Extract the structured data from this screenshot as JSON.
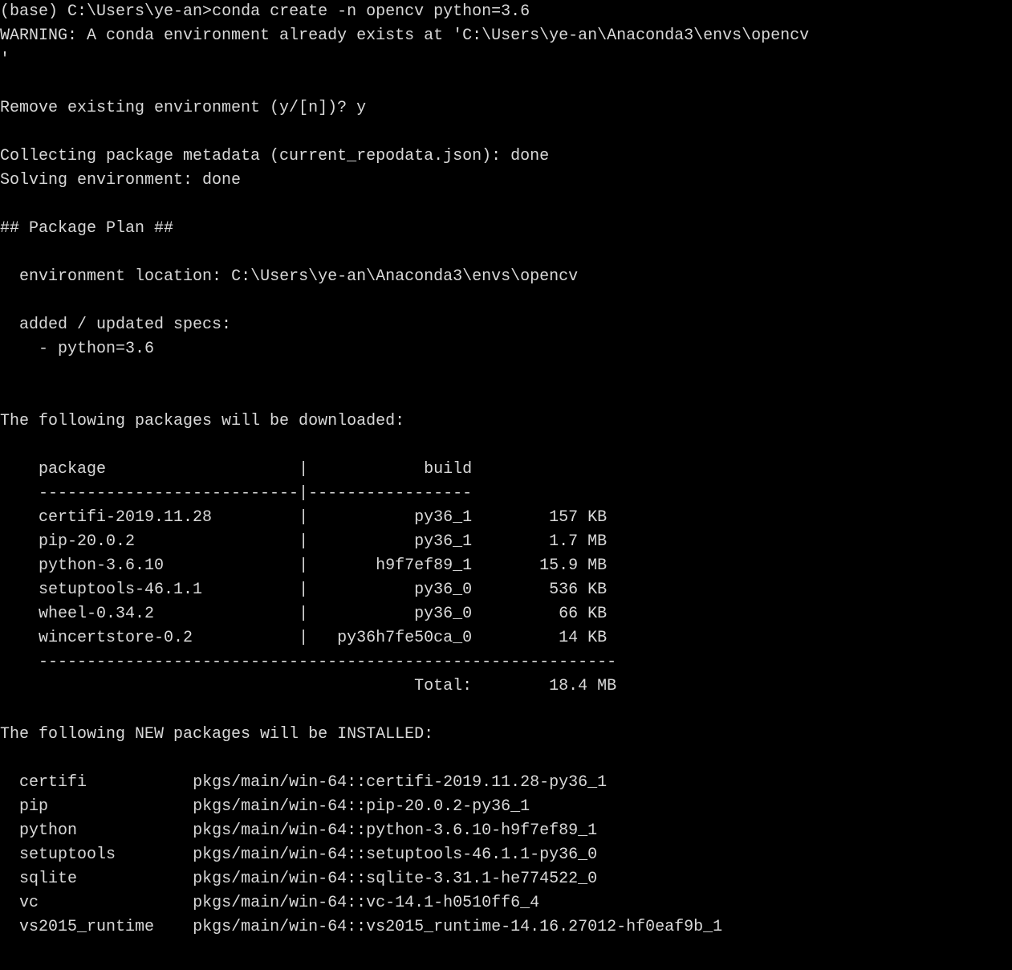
{
  "prompt_env": "(base)",
  "prompt_cwd": "C:\\Users\\ye-an>",
  "prompt_cmd": "conda create -n opencv python=3.6",
  "warning_line": "WARNING: A conda environment already exists at 'C:\\Users\\ye-an\\Anaconda3\\envs\\opencv",
  "warning_tail": "'",
  "remove_prompt": "Remove existing environment (y/[n])?",
  "remove_answer": "y",
  "collecting_line": "Collecting package metadata (current_repodata.json): done",
  "solving_line": "Solving environment: done",
  "plan_header": "## Package Plan ##",
  "env_location_label": "environment location:",
  "env_location_value": "C:\\Users\\ye-an\\Anaconda3\\envs\\opencv",
  "specs_label": "added / updated specs:",
  "spec1": "- python=3.6",
  "dl_intro": "The following packages will be downloaded:",
  "dl_header_package": "package",
  "dl_header_build": "build",
  "dl_sep_top": "    ---------------------------|-----------------",
  "dl_sep_bottom": "    ------------------------------------------------------------",
  "dl_rows": [
    {
      "pkg": "certifi-2019.11.28",
      "build": "py36_1",
      "size": "157 KB"
    },
    {
      "pkg": "pip-20.0.2",
      "build": "py36_1",
      "size": "1.7 MB"
    },
    {
      "pkg": "python-3.6.10",
      "build": "h9f7ef89_1",
      "size": "15.9 MB"
    },
    {
      "pkg": "setuptools-46.1.1",
      "build": "py36_0",
      "size": "536 KB"
    },
    {
      "pkg": "wheel-0.34.2",
      "build": "py36_0",
      "size": "66 KB"
    },
    {
      "pkg": "wincertstore-0.2",
      "build": "py36h7fe50ca_0",
      "size": "14 KB"
    }
  ],
  "total_label": "Total:",
  "total_value": "18.4 MB",
  "install_intro": "The following NEW packages will be INSTALLED:",
  "install_rows": [
    {
      "name": "certifi",
      "spec": "pkgs/main/win-64::certifi-2019.11.28-py36_1"
    },
    {
      "name": "pip",
      "spec": "pkgs/main/win-64::pip-20.0.2-py36_1"
    },
    {
      "name": "python",
      "spec": "pkgs/main/win-64::python-3.6.10-h9f7ef89_1"
    },
    {
      "name": "setuptools",
      "spec": "pkgs/main/win-64::setuptools-46.1.1-py36_0"
    },
    {
      "name": "sqlite",
      "spec": "pkgs/main/win-64::sqlite-3.31.1-he774522_0"
    },
    {
      "name": "vc",
      "spec": "pkgs/main/win-64::vc-14.1-h0510ff6_4"
    },
    {
      "name": "vs2015_runtime",
      "spec": "pkgs/main/win-64::vs2015_runtime-14.16.27012-hf0eaf9b_1"
    }
  ]
}
